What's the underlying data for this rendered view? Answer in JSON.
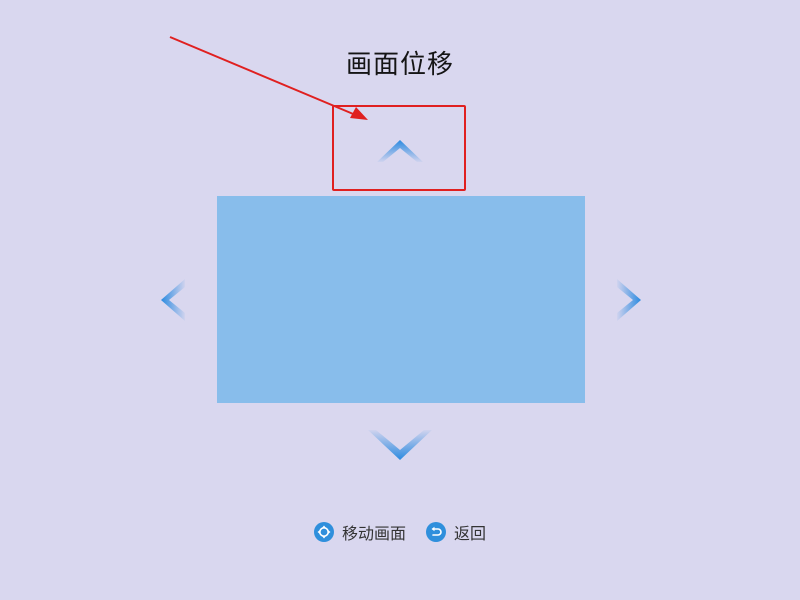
{
  "header": {
    "title": "画面位移"
  },
  "icons": {
    "up": "chevron-up-icon",
    "down": "chevron-down-icon",
    "left": "chevron-left-icon",
    "right": "chevron-right-icon",
    "move": "move-dpad-icon",
    "back": "return-arrow-icon"
  },
  "hints": {
    "move_label": "移动画面",
    "back_label": "返回"
  },
  "colors": {
    "background": "#d9d7ef",
    "preview": "#88bdeb",
    "accent": "#2f8fdc",
    "annotation": "#e02020"
  }
}
